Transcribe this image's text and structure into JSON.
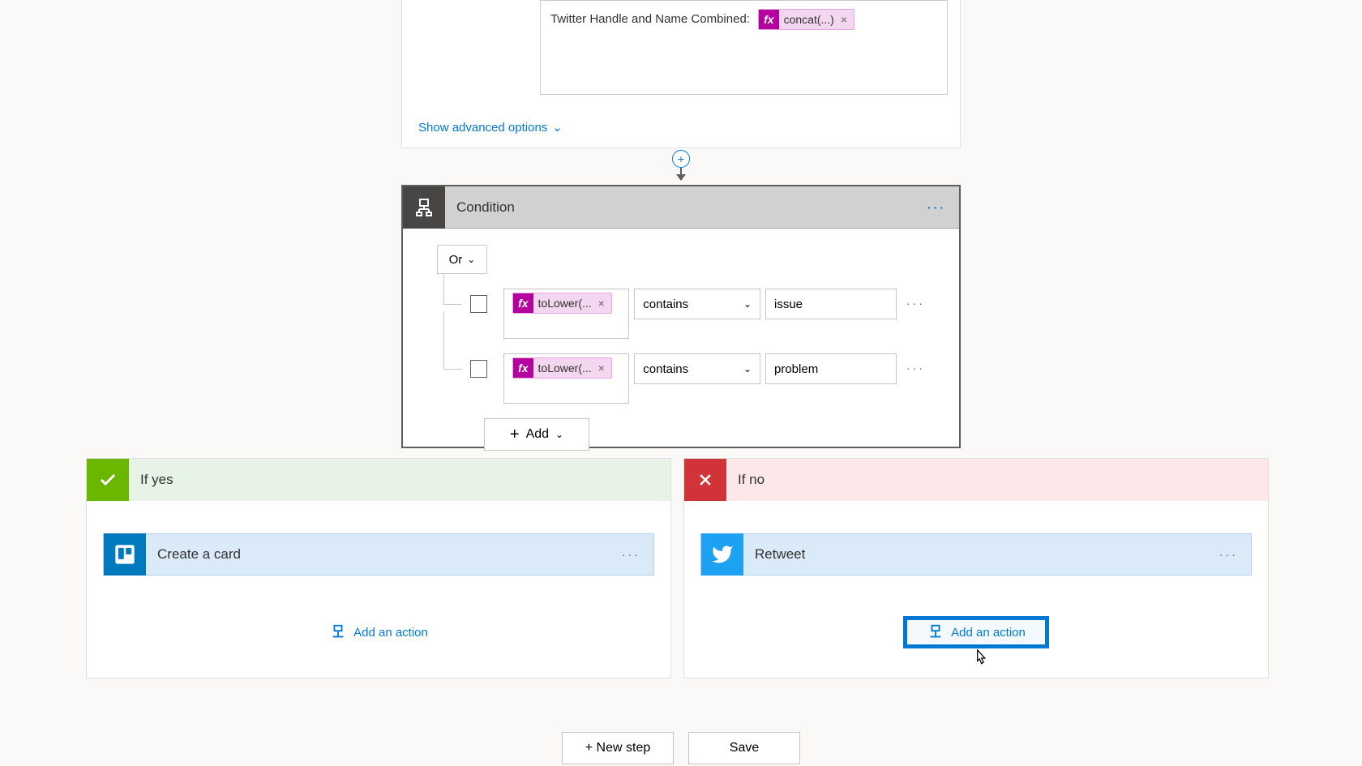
{
  "top_field": {
    "label": "Twitter Handle and Name Combined:",
    "token": "concat(...)"
  },
  "advanced_link": "Show advanced options",
  "condition": {
    "title": "Condition",
    "logic": "Or",
    "rows": [
      {
        "expr": "toLower(...",
        "op": "contains",
        "value": "issue"
      },
      {
        "expr": "toLower(...",
        "op": "contains",
        "value": "problem"
      }
    ],
    "add_label": "Add"
  },
  "branches": {
    "yes": {
      "title": "If yes",
      "action": "Create a card",
      "add_action": "Add an action"
    },
    "no": {
      "title": "If no",
      "action": "Retweet",
      "add_action": "Add an action"
    }
  },
  "buttons": {
    "new_step": "+ New step",
    "save": "Save"
  },
  "fx_symbol": "fx"
}
